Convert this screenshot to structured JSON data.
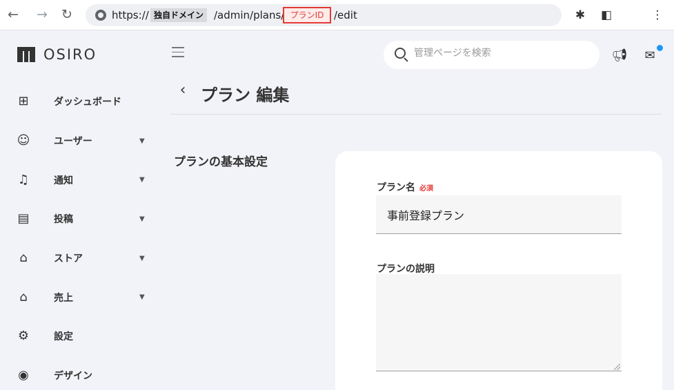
{
  "browser": {
    "back_icon": "arrow-left",
    "forward_icon": "arrow-right",
    "reload_icon": "reload",
    "url": {
      "scheme": "https://",
      "domain": "独自ドメイン",
      "path_before_id": "/admin/plans/",
      "plan_id": "プランID",
      "path_after_id": "/edit"
    },
    "highlight_color": "#e53935"
  },
  "sidebar": {
    "logo_text": "OSIRO",
    "items": [
      {
        "label": "ダッシュボード",
        "icon": "dashboard-icon",
        "glyph": "⊞",
        "expandable": false
      },
      {
        "label": "ユーザー",
        "icon": "user-face-icon",
        "glyph": "☺",
        "expandable": true
      },
      {
        "label": "通知",
        "icon": "bell-plus-icon",
        "glyph": "🔔",
        "expandable": true
      },
      {
        "label": "投稿",
        "icon": "document-icon",
        "glyph": "▤",
        "expandable": true
      },
      {
        "label": "ストア",
        "icon": "store-icon",
        "glyph": "⌂",
        "expandable": true
      },
      {
        "label": "売上",
        "icon": "bank-icon",
        "glyph": "⌂",
        "expandable": true
      },
      {
        "label": "設定",
        "icon": "gear-icon",
        "glyph": "⚙",
        "expandable": false
      },
      {
        "label": "デザイン",
        "icon": "palette-icon",
        "glyph": "◉",
        "expandable": false
      }
    ]
  },
  "header": {
    "search_placeholder": "管理ページを検索"
  },
  "page": {
    "back_glyph": "‹",
    "title": "プラン 編集",
    "section_title": "プランの基本設定",
    "form": {
      "plan_name_label": "プラン名",
      "required_label": "必須",
      "plan_name_value": "事前登録プラン",
      "description_label": "プランの説明",
      "description_value": ""
    }
  },
  "colors": {
    "accent_blue": "#2196f3",
    "required_red": "#e53935",
    "background": "#f2f3f8"
  }
}
